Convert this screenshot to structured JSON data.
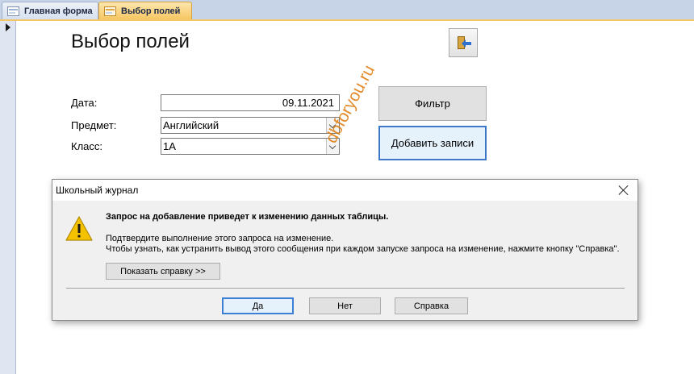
{
  "tabs": [
    {
      "label": "Главная форма",
      "icon": "form-icon",
      "active": false
    },
    {
      "label": "Выбор полей",
      "icon": "form-icon",
      "active": true
    }
  ],
  "form": {
    "title": "Выбор полей",
    "close_icon": "exit-door-icon",
    "fields": {
      "date": {
        "label": "Дата:",
        "value": "09.11.2021"
      },
      "subject": {
        "label": "Предмет:",
        "value": "Английский"
      },
      "class": {
        "label": "Класс:",
        "value": "1А"
      }
    },
    "buttons": {
      "filter": "Фильтр",
      "add_records": "Добавить записи"
    }
  },
  "watermark": "dbforyou.ru",
  "dialog": {
    "title": "Школьный журнал",
    "icon": "warning-icon",
    "heading": "Запрос на добавление приведет к изменению данных таблицы.",
    "line1": "Подтвердите выполнение этого запроса на изменение.",
    "line2": "Чтобы узнать, как устранить вывод этого сообщения при каждом запуске запроса на изменение, нажмите кнопку \"Справка\".",
    "show_help_label": "Показать справку >>",
    "buttons": {
      "yes": "Да",
      "no": "Нет",
      "help": "Справка"
    }
  },
  "colors": {
    "active_tab": "#f6c763",
    "warning": "#f5c200",
    "default_button_border": "#3c7fd4",
    "watermark": "#e07f16"
  }
}
